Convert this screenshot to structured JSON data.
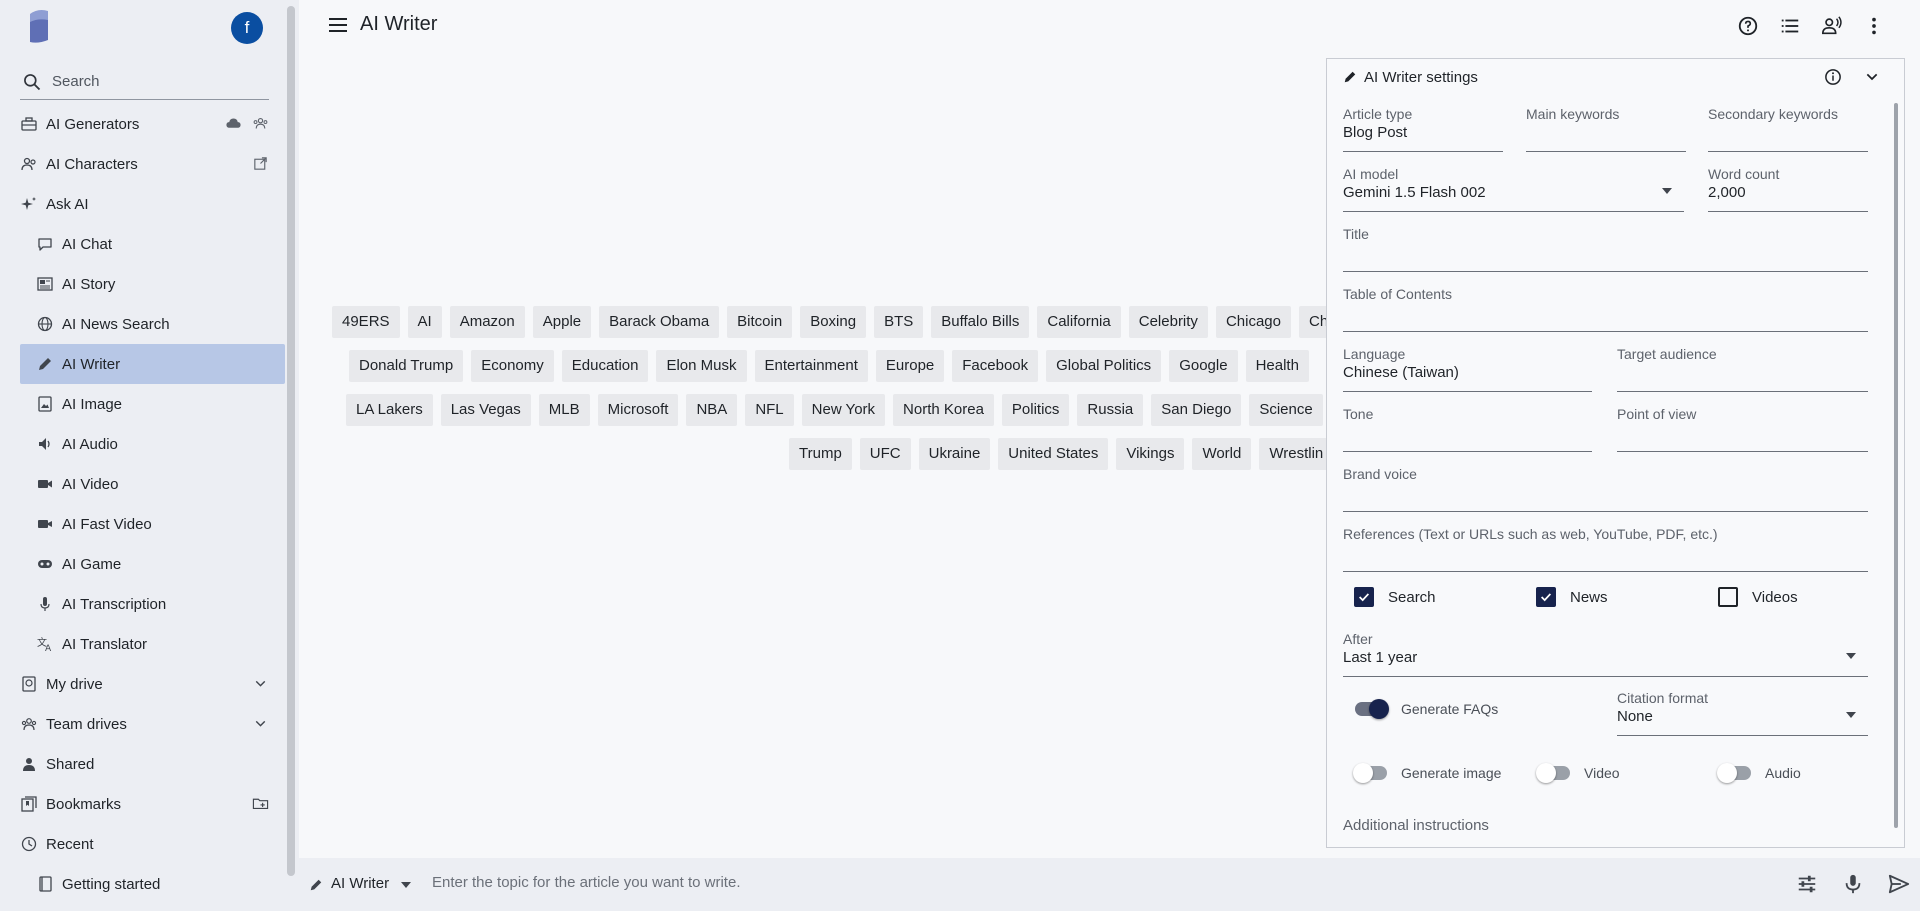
{
  "sidebar": {
    "avatar_letter": "f",
    "search_placeholder": "Search",
    "items": [
      {
        "label": "AI Generators",
        "icon": "toolbox-icon"
      },
      {
        "label": "AI Characters",
        "icon": "characters-icon"
      },
      {
        "label": "Ask AI",
        "icon": "sparkle-icon"
      },
      {
        "label": "AI Chat",
        "icon": "chat-bubble-icon"
      },
      {
        "label": "AI Story",
        "icon": "story-icon"
      },
      {
        "label": "AI News Search",
        "icon": "globe-icon"
      },
      {
        "label": "AI Writer",
        "icon": "pen-icon"
      },
      {
        "label": "AI Image",
        "icon": "image-icon"
      },
      {
        "label": "AI Audio",
        "icon": "speaker-icon"
      },
      {
        "label": "AI Video",
        "icon": "video-icon"
      },
      {
        "label": "AI Fast Video",
        "icon": "camera-icon"
      },
      {
        "label": "AI Game",
        "icon": "gamepad-icon"
      },
      {
        "label": "AI Transcription",
        "icon": "mic-icon"
      },
      {
        "label": "AI Translator",
        "icon": "translate-icon"
      },
      {
        "label": "My drive",
        "icon": "drive-icon"
      },
      {
        "label": "Team drives",
        "icon": "team-icon"
      },
      {
        "label": "Shared",
        "icon": "person-icon"
      },
      {
        "label": "Bookmarks",
        "icon": "bookmarks-icon"
      },
      {
        "label": "Recent",
        "icon": "clock-icon"
      },
      {
        "label": "Getting started",
        "icon": "book-icon"
      }
    ]
  },
  "header": {
    "title": "AI Writer"
  },
  "topics": {
    "row1": [
      "49ERS",
      "AI",
      "Amazon",
      "Apple",
      "Barack Obama",
      "Bitcoin",
      "Boxing",
      "BTS",
      "Buffalo Bills",
      "California",
      "Celebrity",
      "Chicago",
      "Chi"
    ],
    "row2": [
      "Donald Trump",
      "Economy",
      "Education",
      "Elon Musk",
      "Entertainment",
      "Europe",
      "Facebook",
      "Global Politics",
      "Google",
      "Health"
    ],
    "row3": [
      "LA Lakers",
      "Las Vegas",
      "MLB",
      "Microsoft",
      "NBA",
      "NFL",
      "New York",
      "North Korea",
      "Politics",
      "Russia",
      "San Diego",
      "Science"
    ],
    "row4": [
      "Trump",
      "UFC",
      "Ukraine",
      "United States",
      "Vikings",
      "World",
      "Wrestlin"
    ]
  },
  "settings": {
    "title": "AI Writer settings",
    "article_type": {
      "label": "Article type",
      "value": "Blog Post"
    },
    "main_keywords": {
      "label": "Main keywords",
      "value": ""
    },
    "secondary_keywords": {
      "label": "Secondary keywords",
      "value": ""
    },
    "ai_model": {
      "label": "AI model",
      "value": "Gemini 1.5 Flash 002"
    },
    "word_count": {
      "label": "Word count",
      "value": "2,000"
    },
    "title_field": {
      "label": "Title",
      "value": ""
    },
    "toc": {
      "label": "Table of Contents",
      "value": ""
    },
    "language": {
      "label": "Language",
      "value": "Chinese (Taiwan)"
    },
    "target_audience": {
      "label": "Target audience",
      "value": ""
    },
    "tone": {
      "label": "Tone",
      "value": ""
    },
    "point_of_view": {
      "label": "Point of view",
      "value": ""
    },
    "brand_voice": {
      "label": "Brand voice",
      "value": ""
    },
    "references": {
      "label": "References (Text or URLs such as web, YouTube, PDF, etc.)",
      "value": ""
    },
    "checkboxes": [
      {
        "label": "Search",
        "checked": true
      },
      {
        "label": "News",
        "checked": true
      },
      {
        "label": "Videos",
        "checked": false
      }
    ],
    "after": {
      "label": "After",
      "value": "Last 1 year"
    },
    "generate_faqs": {
      "label": "Generate FAQs",
      "on": true
    },
    "citation_format": {
      "label": "Citation format",
      "value": "None"
    },
    "generate_image": {
      "label": "Generate image",
      "on": false
    },
    "video": {
      "label": "Video",
      "on": false
    },
    "audio": {
      "label": "Audio",
      "on": false
    },
    "additional_instructions": "Additional instructions"
  },
  "bottom": {
    "mode": "AI Writer",
    "placeholder": "Enter the topic for the article you want to write."
  },
  "colors": {
    "accent": "#17234d",
    "avatar": "#0a4ea1",
    "active_item": "#b7c7e6"
  }
}
